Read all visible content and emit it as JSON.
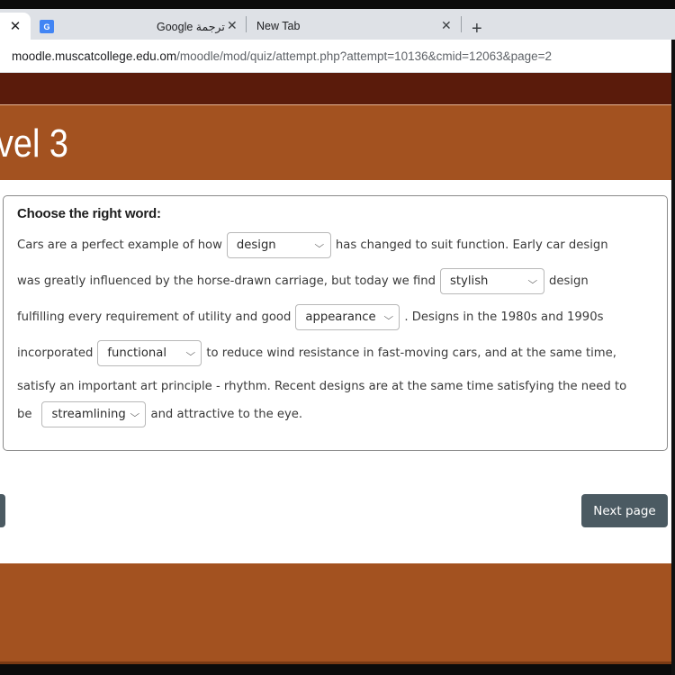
{
  "browser": {
    "active_tab_close": "✕",
    "tabs": [
      {
        "title": "Google ترجمة",
        "close": "✕"
      },
      {
        "title": "New Tab",
        "close": "✕"
      }
    ],
    "new_tab": "+",
    "url_host": "moodle.muscatcollege.edu.om",
    "url_path": "/moodle/mod/quiz/attempt.php?attempt=10136&cmid=12063&page=2"
  },
  "header": {
    "title": "vel 3"
  },
  "question": {
    "title": "Choose the right word:",
    "l1_a": "Cars are a perfect example of how",
    "s1": "design",
    "l1_b": "has changed to suit function. Early car design",
    "l2_a": "was greatly influenced by the horse-drawn carriage, but today we find",
    "s2": "stylish",
    "l2_b": "design",
    "l3_a": "fulfilling every requirement of utility and good",
    "s3": "appearance",
    "l3_b": ". Designs in the 1980s and 1990s",
    "l4_a": "incorporated",
    "s4": "functional",
    "l4_b": "to reduce wind resistance in fast-moving cars, and at the same time,",
    "l5": "satisfy an important art principle - rhythm. Recent designs are at the same time satisfying the need to",
    "l6_a": "be",
    "s5": "streamlining",
    "l6_b": "and attractive to the eye."
  },
  "nav": {
    "next_label": "Next page"
  },
  "colors": {
    "header_orange": "#a35220",
    "maroon": "#5a1b0b",
    "button": "#4b5a62"
  }
}
